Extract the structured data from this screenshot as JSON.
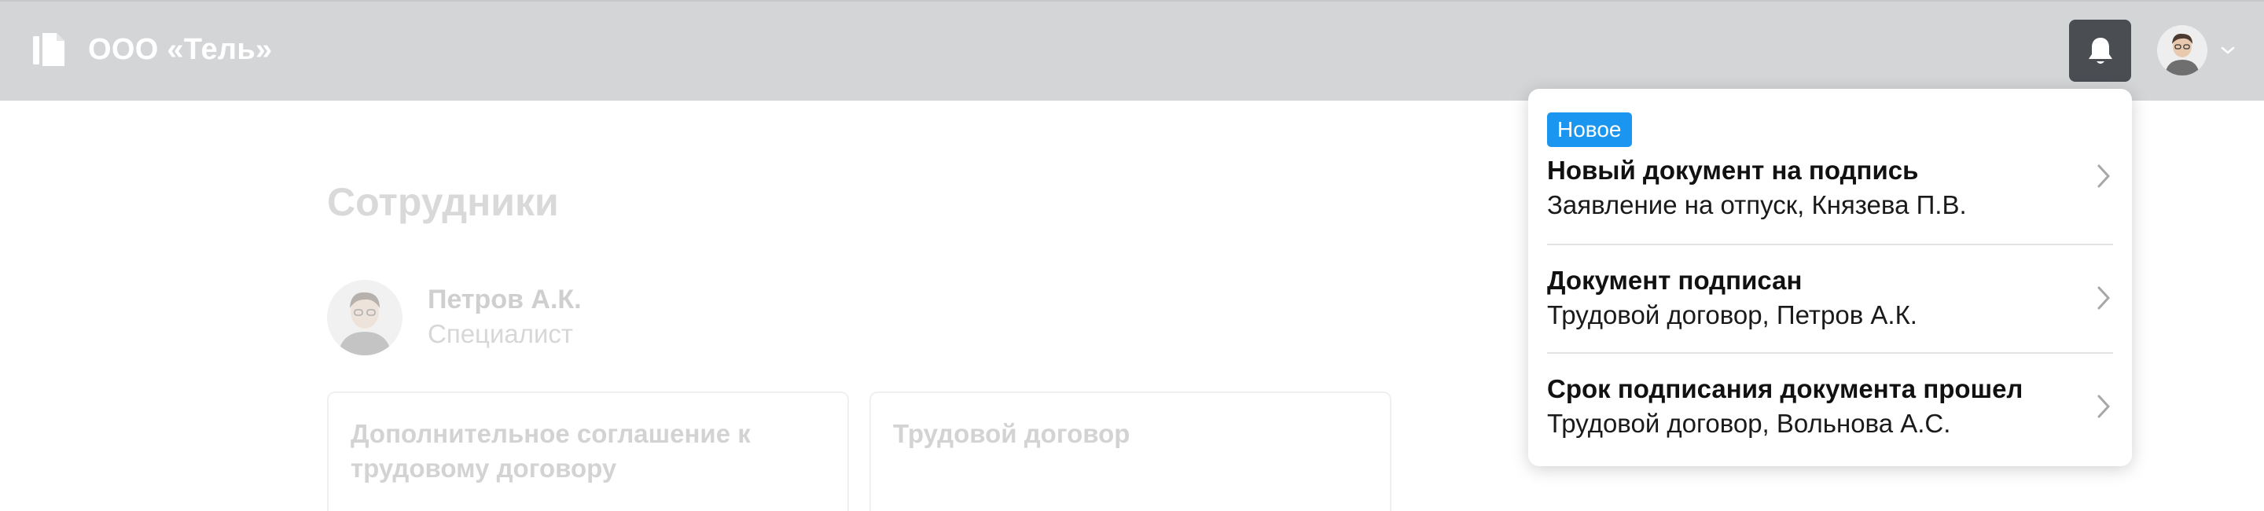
{
  "header": {
    "company_name": "ООО «Тель»",
    "logo_icon": "document-icon",
    "bell_icon": "bell-icon",
    "chevron_icon": "chevron-down-icon"
  },
  "page": {
    "title": "Сотрудники",
    "employee": {
      "name": "Петров А.К.",
      "role": "Специалист"
    },
    "documents": [
      {
        "title": "Дополнительное соглашение к трудовому договору"
      },
      {
        "title": "Трудовой договор"
      }
    ]
  },
  "notifications": [
    {
      "badge": "Новое",
      "title": "Новый документ на подпись",
      "subtitle": "Заявление на отпуск, Князева П.В."
    },
    {
      "title": "Документ подписан",
      "subtitle": "Трудовой договор, Петров А.К."
    },
    {
      "title": "Срок подписания документа прошел",
      "subtitle": "Трудовой договор, Вольнова А.С."
    }
  ],
  "colors": {
    "header_bg": "#d4d5d7",
    "bell_button_bg": "#4a4e53",
    "badge_bg": "#1a95f0"
  }
}
